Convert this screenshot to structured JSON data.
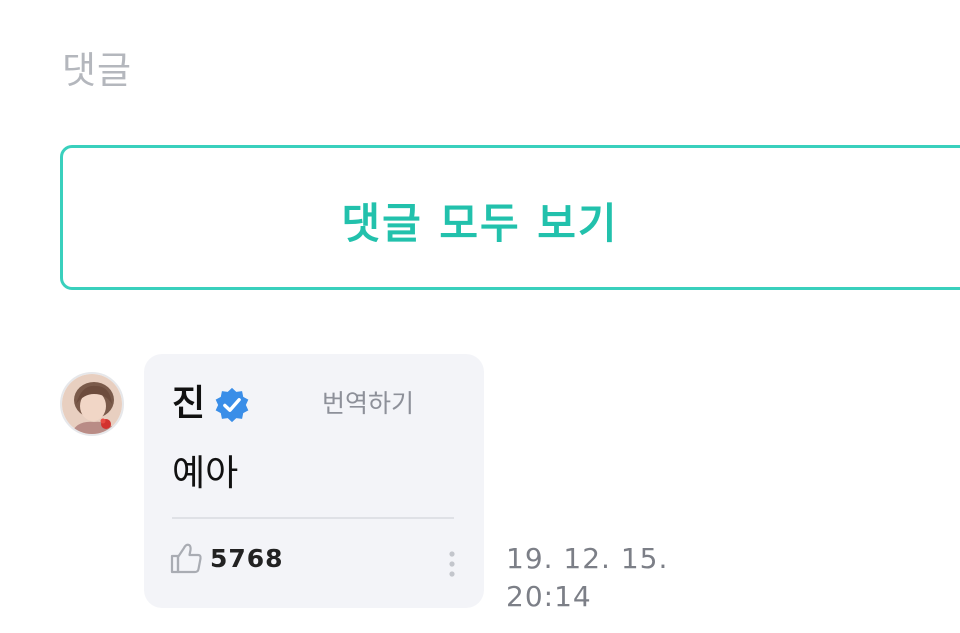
{
  "section": {
    "title": "댓글"
  },
  "view_all": {
    "label": "댓글 모두 보기"
  },
  "comment": {
    "author": "진",
    "verified": true,
    "translate_label": "번역하기",
    "text": "예아",
    "likes": "5768",
    "date": "19. 12. 15.",
    "time": "20:14"
  },
  "icons": {
    "verified": "verified-badge-icon",
    "like": "thumbs-up-icon",
    "more": "more-vertical-icon"
  },
  "colors": {
    "accent": "#22c1ac",
    "border": "#39d0bd",
    "bubble_bg": "#f3f4f8",
    "verified_blue": "#3a8ee8",
    "muted_text": "#b4b7bd"
  }
}
